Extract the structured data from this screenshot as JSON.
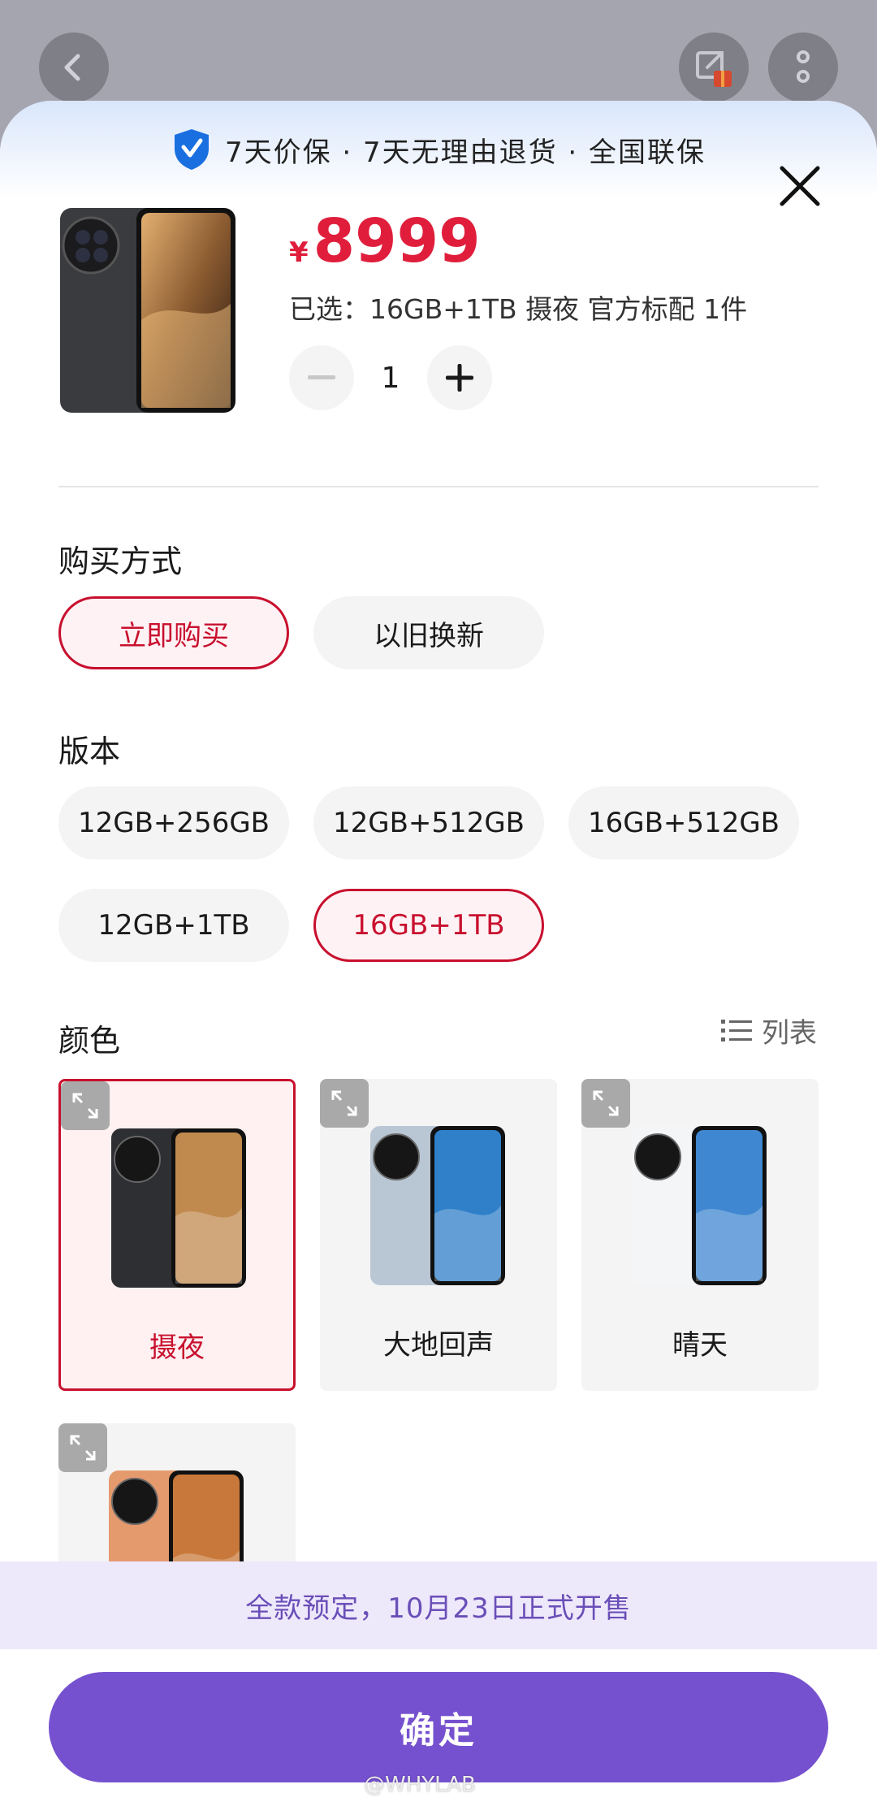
{
  "guarantee": {
    "text": "7天价保 · 7天无理由退货 · 全国联保"
  },
  "product": {
    "currency": "¥",
    "price": "8999",
    "selected_summary": "已选：16GB+1TB 摄夜 官方标配 1件",
    "quantity": "1"
  },
  "purchase": {
    "title": "购买方式",
    "options": [
      {
        "label": "立即购买",
        "selected": true
      },
      {
        "label": "以旧换新",
        "selected": false
      }
    ]
  },
  "version": {
    "title": "版本",
    "options": [
      {
        "label": "12GB+256GB",
        "selected": false
      },
      {
        "label": "12GB+512GB",
        "selected": false
      },
      {
        "label": "16GB+512GB",
        "selected": false
      },
      {
        "label": "12GB+1TB",
        "selected": false
      },
      {
        "label": "16GB+1TB",
        "selected": true
      }
    ]
  },
  "color": {
    "title": "颜色",
    "list_toggle": "列表",
    "options": [
      {
        "label": "摄夜",
        "selected": true,
        "body": "#2e2f33",
        "screen": "#c08a4e"
      },
      {
        "label": "大地回声",
        "selected": false,
        "body": "#b9c6d4",
        "screen": "#2f7fc9"
      },
      {
        "label": "晴天",
        "selected": false,
        "body": "#f4f5f7",
        "screen": "#3f87d0"
      },
      {
        "label": "",
        "selected": false,
        "body": "#e59a6e",
        "screen": "#c8783a"
      }
    ]
  },
  "presale_notice": "全款预定，10月23日正式开售",
  "confirm_label": "确定",
  "watermark": "@WHYLAB",
  "colors": {
    "accent_red": "#c8102e",
    "price_red": "#e01e3c",
    "purple": "#7651cf"
  }
}
